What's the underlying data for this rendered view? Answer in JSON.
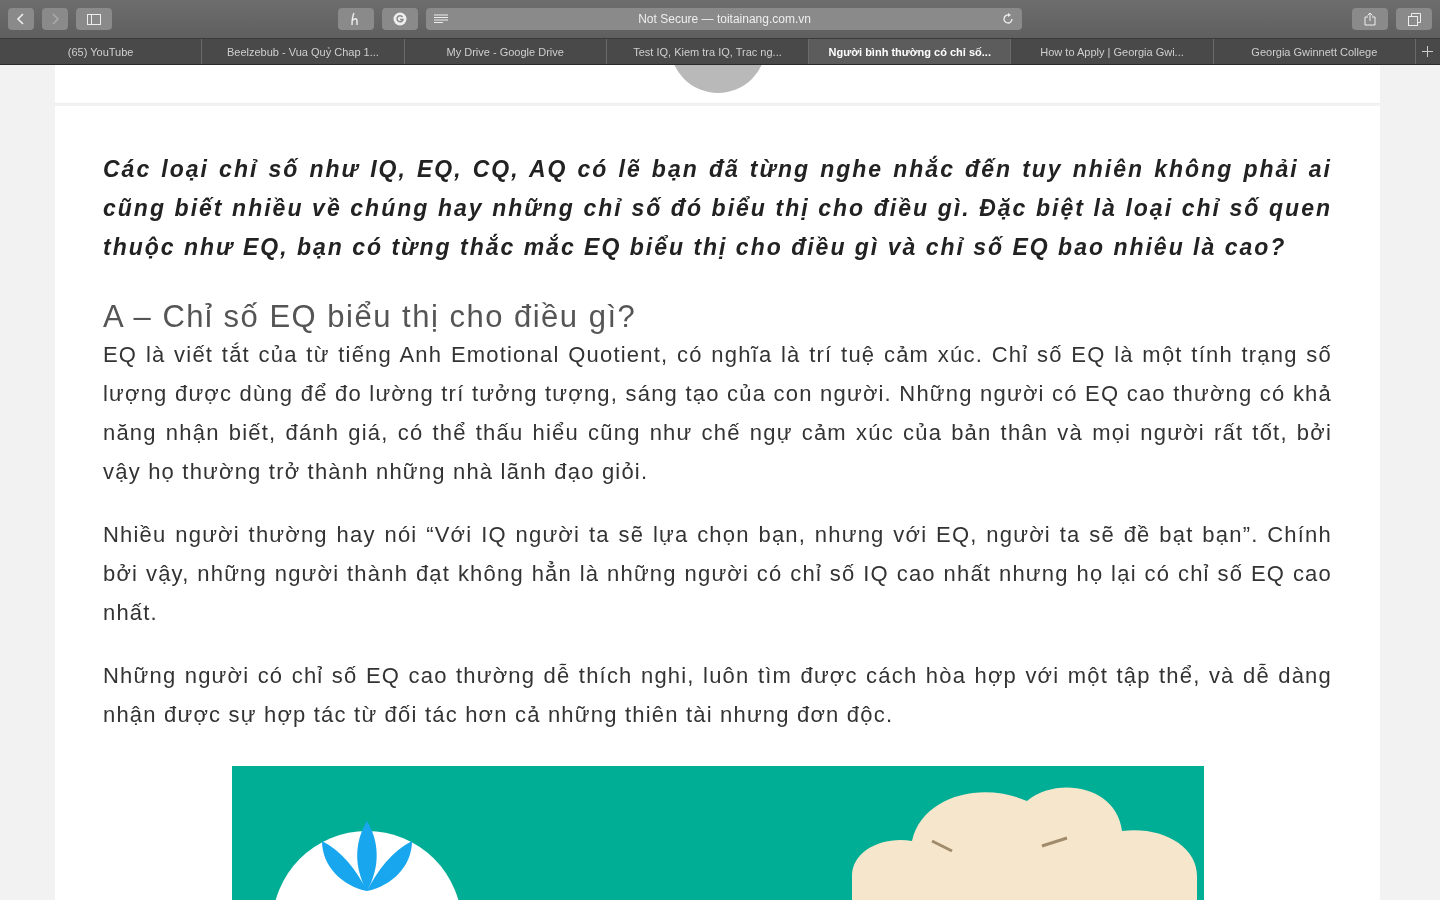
{
  "toolbar": {
    "address": "Not Secure — toitainang.com.vn"
  },
  "tabs": [
    {
      "label": "(65) YouTube",
      "selected": false
    },
    {
      "label": "Beelzebub - Vua Quỷ Chap 1...",
      "selected": false
    },
    {
      "label": "My Drive - Google Drive",
      "selected": false
    },
    {
      "label": "Test IQ, Kiem tra IQ, Trac ng...",
      "selected": false
    },
    {
      "label": "Người bình thường có chỉ số...",
      "selected": true
    },
    {
      "label": "How to Apply | Georgia Gwi...",
      "selected": false
    },
    {
      "label": "Georgia Gwinnett College",
      "selected": false
    }
  ],
  "article": {
    "intro": "Các loại chỉ số như IQ, EQ, CQ, AQ  có lẽ bạn đã từng nghe nhắc đến tuy nhiên không phải ai cũng biết nhiều về chúng hay những chỉ số đó biểu thị cho điều gì. Đặc biệt là loại chỉ số quen thuộc như EQ, bạn có từng thắc mắc EQ biểu thị cho điều gì và chỉ số EQ  bao nhiêu là cao?",
    "heading": "A – Chỉ số EQ biểu thị cho điều gì?",
    "paragraphs": [
      "EQ là viết tắt của từ tiếng Anh Emotional Quotient, có nghĩa là trí tuệ cảm xúc. Chỉ số EQ là một tính trạng số lượng được dùng để đo lường trí tưởng tượng, sáng tạo của con người. Những người có EQ cao thường có khả năng nhận biết, đánh giá, có thể thấu hiểu cũng như chế ngự cảm xúc của bản thân và mọi người rất tốt, bởi vậy họ thường trở thành những nhà lãnh đạo giỏi.",
      "Nhiều người thường hay nói “Với IQ người ta sẽ lựa chọn bạn, nhưng với EQ, người ta sẽ đề bạt bạn”. Chính bởi vậy, những người thành đạt không hẳn là những người có chỉ số IQ cao nhất nhưng họ lại có chỉ số EQ cao nhất.",
      "Những người có chỉ số EQ cao thường dễ thích nghi, luôn tìm được cách hòa hợp với một tập thể, và dễ dàng nhận được sự hợp tác từ đối tác hơn cả những thiên tài nhưng đơn độc."
    ]
  }
}
